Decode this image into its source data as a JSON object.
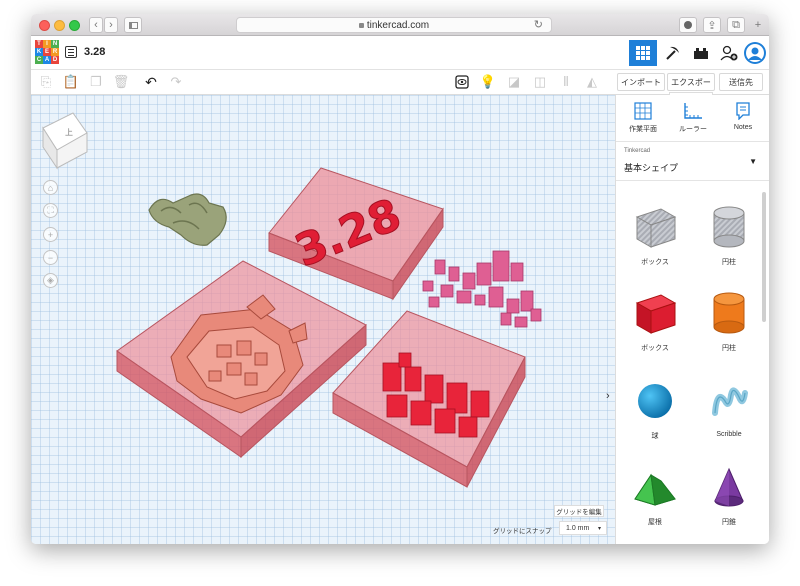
{
  "browser": {
    "url": "tinkercad.com"
  },
  "app": {
    "logo_letters": [
      "T",
      "I",
      "N",
      "K",
      "E",
      "R",
      "C",
      "A",
      "D"
    ],
    "design_name": "3.28"
  },
  "toolbar": {
    "import_label": "インポート",
    "export_label": "エクスポー",
    "export_overflow": "ト",
    "send_label": "送信先"
  },
  "right_tools": {
    "workplane_label": "作業平面",
    "ruler_label": "ルーラー",
    "notes_label": "Notes"
  },
  "library": {
    "source": "Tinkercad",
    "category": "基本シェイプ",
    "shapes": [
      {
        "label": "ボックス",
        "icon": "striped-box-icon"
      },
      {
        "label": "円柱",
        "icon": "striped-cylinder-icon"
      },
      {
        "label": "ボックス",
        "icon": "red-box-icon"
      },
      {
        "label": "円柱",
        "icon": "orange-cylinder-icon"
      },
      {
        "label": "球",
        "icon": "blue-sphere-icon"
      },
      {
        "label": "Scribble",
        "icon": "scribble-icon"
      },
      {
        "label": "屋根",
        "icon": "green-roof-icon"
      },
      {
        "label": "円錐",
        "icon": "purple-cone-icon"
      }
    ]
  },
  "workplane": {
    "viewcube_label": "上",
    "grid_edit_label": "グリッドを編集",
    "snap_label": "グリッドにスナップ",
    "snap_value": "1.0 mm",
    "model_text": "3.28"
  },
  "colors": {
    "accent": "#1e7fd8",
    "hole_red": "#e0505a",
    "solid_red": "#e8243a",
    "pink": "#d9508a",
    "olive": "#8f9970",
    "salmon": "#e07a6a"
  }
}
